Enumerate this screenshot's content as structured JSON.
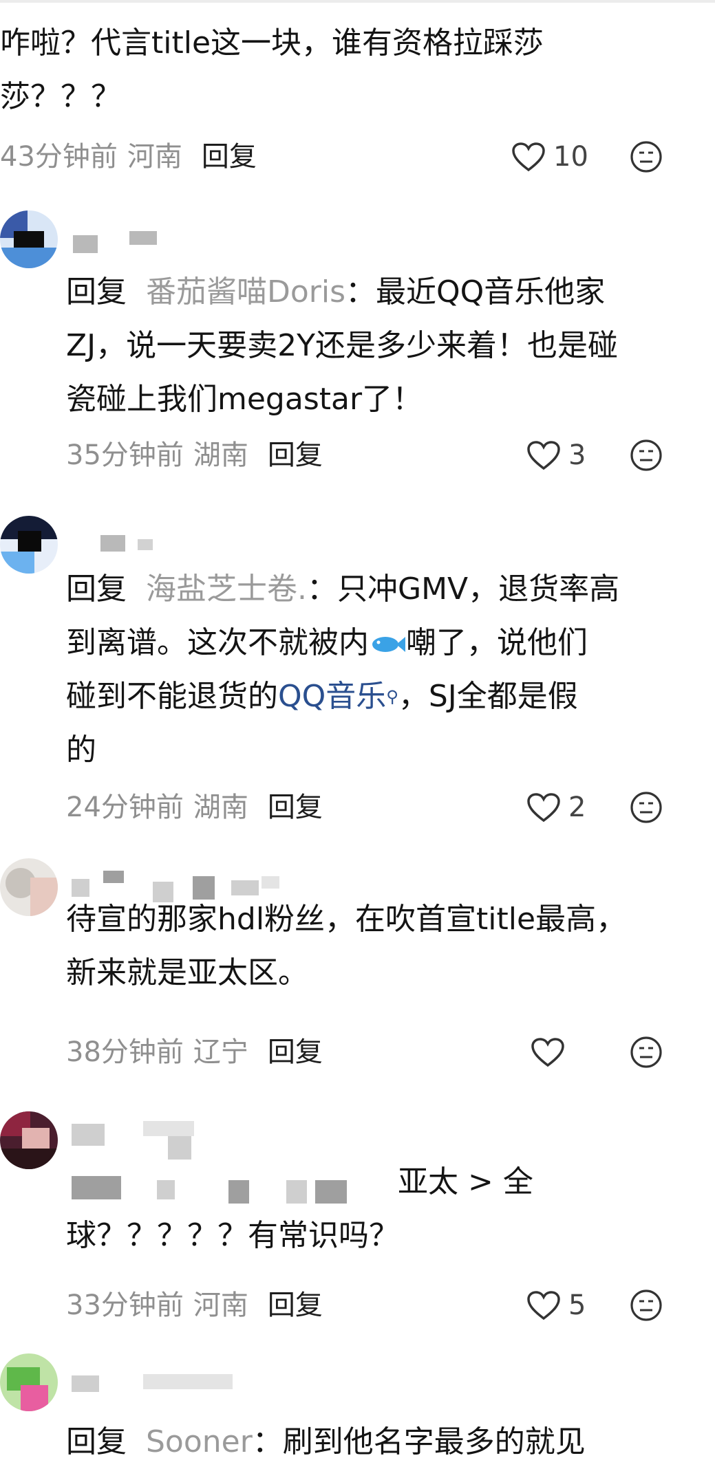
{
  "comments": [
    {
      "text": "咋啦？代言title这一块，谁有资格拉踩莎\n莎？？？",
      "time": "43分钟前",
      "region": "河南",
      "reply_label": "回复",
      "likes": "10"
    },
    {
      "reply_prefix": "回复",
      "reply_to": "番茄酱喵Doris",
      "text": "：最近QQ音乐他家\nZJ，说一天要卖2Y还是多少来着！也是碰\n瓷碰上我们megastar了！",
      "time": "35分钟前",
      "region": "湖南",
      "reply_label": "回复",
      "likes": "3"
    },
    {
      "reply_prefix": "回复",
      "reply_to": "海盐芝士卷.",
      "text_a": "：只冲GMV，退货率高\n到离谱。这次不就被内",
      "text_b": "嘲了，说他们\n碰到不能退货的",
      "link": "QQ音乐",
      "text_c": "，SJ全都是假\n的",
      "time": "24分钟前",
      "region": "湖南",
      "reply_label": "回复",
      "likes": "2"
    },
    {
      "text": "待宣的那家hdl粉丝，在吹首宣title最高，\n新来就是亚太区。",
      "time": "38分钟前",
      "region": "辽宁",
      "reply_label": "回复",
      "likes": ""
    },
    {
      "text_a": "亚太 > 全",
      "text_b": "球？？？？？有常识吗？",
      "time": "33分钟前",
      "region": "河南",
      "reply_label": "回复",
      "likes": "5"
    },
    {
      "reply_prefix": "回复",
      "reply_to": "Sooner",
      "text": "：刷到他名字最多的就见",
      "time": "",
      "region": "",
      "reply_label": "",
      "likes": ""
    }
  ],
  "icons": {
    "like": "heart-outline-icon",
    "dislike": "neutral-face-icon",
    "search": "search-icon",
    "fish": "fish-emoji-icon"
  },
  "colors": {
    "text": "#141414",
    "muted": "#8f8f8f",
    "reply_target": "#9a9a9a",
    "link": "#2a4f8f"
  }
}
